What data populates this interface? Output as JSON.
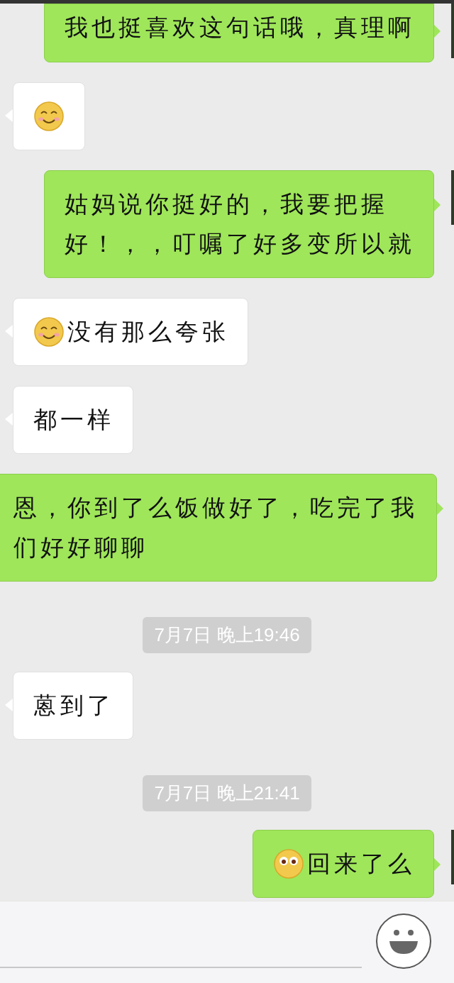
{
  "messages": [
    {
      "kind": "sent",
      "lines": [
        "我也挺喜欢这句话哦，真理啊"
      ]
    },
    {
      "kind": "received",
      "emoji": {
        "kind": "smile"
      }
    },
    {
      "kind": "sent",
      "lines": [
        "姑妈说你挺好的，我要把握",
        "好！，，叮嘱了好多变所以就"
      ]
    },
    {
      "kind": "received",
      "emoji": {
        "kind": "smile"
      },
      "lines": [
        "没有那么夸张"
      ]
    },
    {
      "kind": "received",
      "lines": [
        "都一样"
      ]
    },
    {
      "kind": "sent",
      "lines": [
        "恩，你到了么饭做好了，吃完了我",
        "们好好聊聊"
      ]
    },
    {
      "kind": "time",
      "text": "7月7日 晚上19:46"
    },
    {
      "kind": "received",
      "lines": [
        "蒽到了"
      ]
    },
    {
      "kind": "time",
      "text": "7月7日 晚上21:41"
    },
    {
      "kind": "sent",
      "emoji": {
        "kind": "wide-eyes"
      },
      "lines": [
        "回来了么"
      ]
    }
  ]
}
